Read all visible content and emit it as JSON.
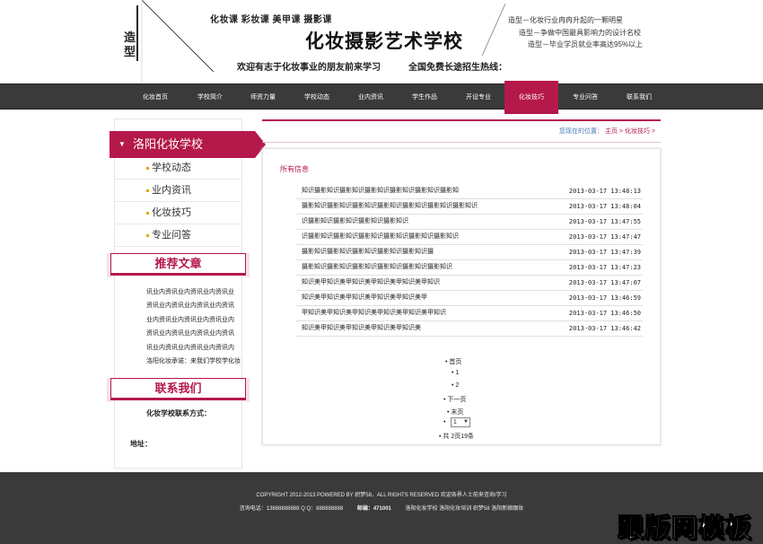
{
  "header": {
    "logo_text": "造型",
    "courses": "化妆课 彩妆课 美甲课 摄影课",
    "title": "化妆摄影艺术学校",
    "welcome": "欢迎有志于化妆事业的朋友前来学习",
    "hotline": "全国免费长途招生热线：",
    "slogans": [
      "造型－化妆行业冉冉升起的一颗明星",
      "造型－争做中国最具影响力的设计名校",
      "造型－毕业学员就业率高达95%以上"
    ]
  },
  "nav": {
    "items": [
      "化妆首页",
      "学校简介",
      "师资力量",
      "学校动态",
      "业内资讯",
      "学生作品",
      "开设专业",
      "化妆技巧",
      "专业问答",
      "联系我们"
    ],
    "active_index": 7
  },
  "sidebar": {
    "school_name": "洛阳化妆学校",
    "menu": [
      "学校动态",
      "业内资讯",
      "化妆技巧",
      "专业问答"
    ],
    "recommended_title": "推荐文章",
    "recommended": [
      "讯业内资讯业内资讯业内资讯业",
      "资讯业内资讯业内资讯业内资讯",
      "业内资讯业内资讯业内资讯业内",
      "资讯业内资讯业内资讯业内资讯",
      "讯业内资讯业内资讯业内资讯内",
      "洛阳化妆承诺：来我们学校学化妆"
    ],
    "contact_title": "联系我们",
    "contact_label": "化妆学校联系方式：",
    "address_label": "地址："
  },
  "breadcrumb": {
    "label": "您现在的位置：",
    "home": "主页",
    "current": "化妆技巧"
  },
  "main": {
    "section_title": "所有信息",
    "articles": [
      {
        "title": "知识摄影知识摄影知识摄影知识摄影知识摄影知识摄影知",
        "date": "2013-03-17 13:48:13"
      },
      {
        "title": "摄影知识摄影知识摄影知识摄影知识摄影知识摄影知识摄影知识",
        "date": "2013-03-17 13:48:04"
      },
      {
        "title": "识摄影知识摄影知识摄影知识摄影知识",
        "date": "2013-03-17 13:47:55"
      },
      {
        "title": "识摄影知识摄影知识摄影知识摄影知识摄影知识摄影知识",
        "date": "2013-03-17 13:47:47"
      },
      {
        "title": "摄影知识摄影知识摄影知识摄影知识摄影知识摄",
        "date": "2013-03-17 13:47:39"
      },
      {
        "title": "摄影知识摄影知识摄影知识摄影知识摄影知识摄影知识",
        "date": "2013-03-17 13:47:23"
      },
      {
        "title": "知识美甲知识美甲知识美甲知识美甲知识美甲知识",
        "date": "2013-03-17 13:47:07"
      },
      {
        "title": "知识美甲知识美甲知识美甲知识美甲知识美甲",
        "date": "2013-03-17 13:46:59"
      },
      {
        "title": "甲知识美甲知识美甲知识美甲知识美甲知识美甲知识",
        "date": "2013-03-17 13:46:50"
      },
      {
        "title": "知识美甲知识美甲知识美甲知识美甲知识美",
        "date": "2013-03-17 13:46:42"
      }
    ]
  },
  "pagination": {
    "first": "首页",
    "pages": [
      "1",
      "2"
    ],
    "next": "下一页",
    "last": "末页",
    "select_value": "1",
    "summary": "共 2页19条"
  },
  "footer": {
    "copyright": "COPYRIGHT 2012-2013 POWERED BY 织梦58，ALL RIGHTS RESERVED 欢迎各界人士前来咨询/学习",
    "contact_line": "咨询电话：13888888888 Q Q：888888888",
    "postcode": "邮编：471001",
    "keywords": "洛阳化妆学校 洛阳化妆培训 织梦58 洛阳新娘跟妆"
  },
  "watermark": "跟版网模板",
  "colors": {
    "accent": "#b5184a",
    "nav_bg": "#3a3a3a",
    "footer_bg": "#3a3a3a",
    "dot": "#e8a400",
    "breadcrumb_label": "#4a78b8"
  }
}
